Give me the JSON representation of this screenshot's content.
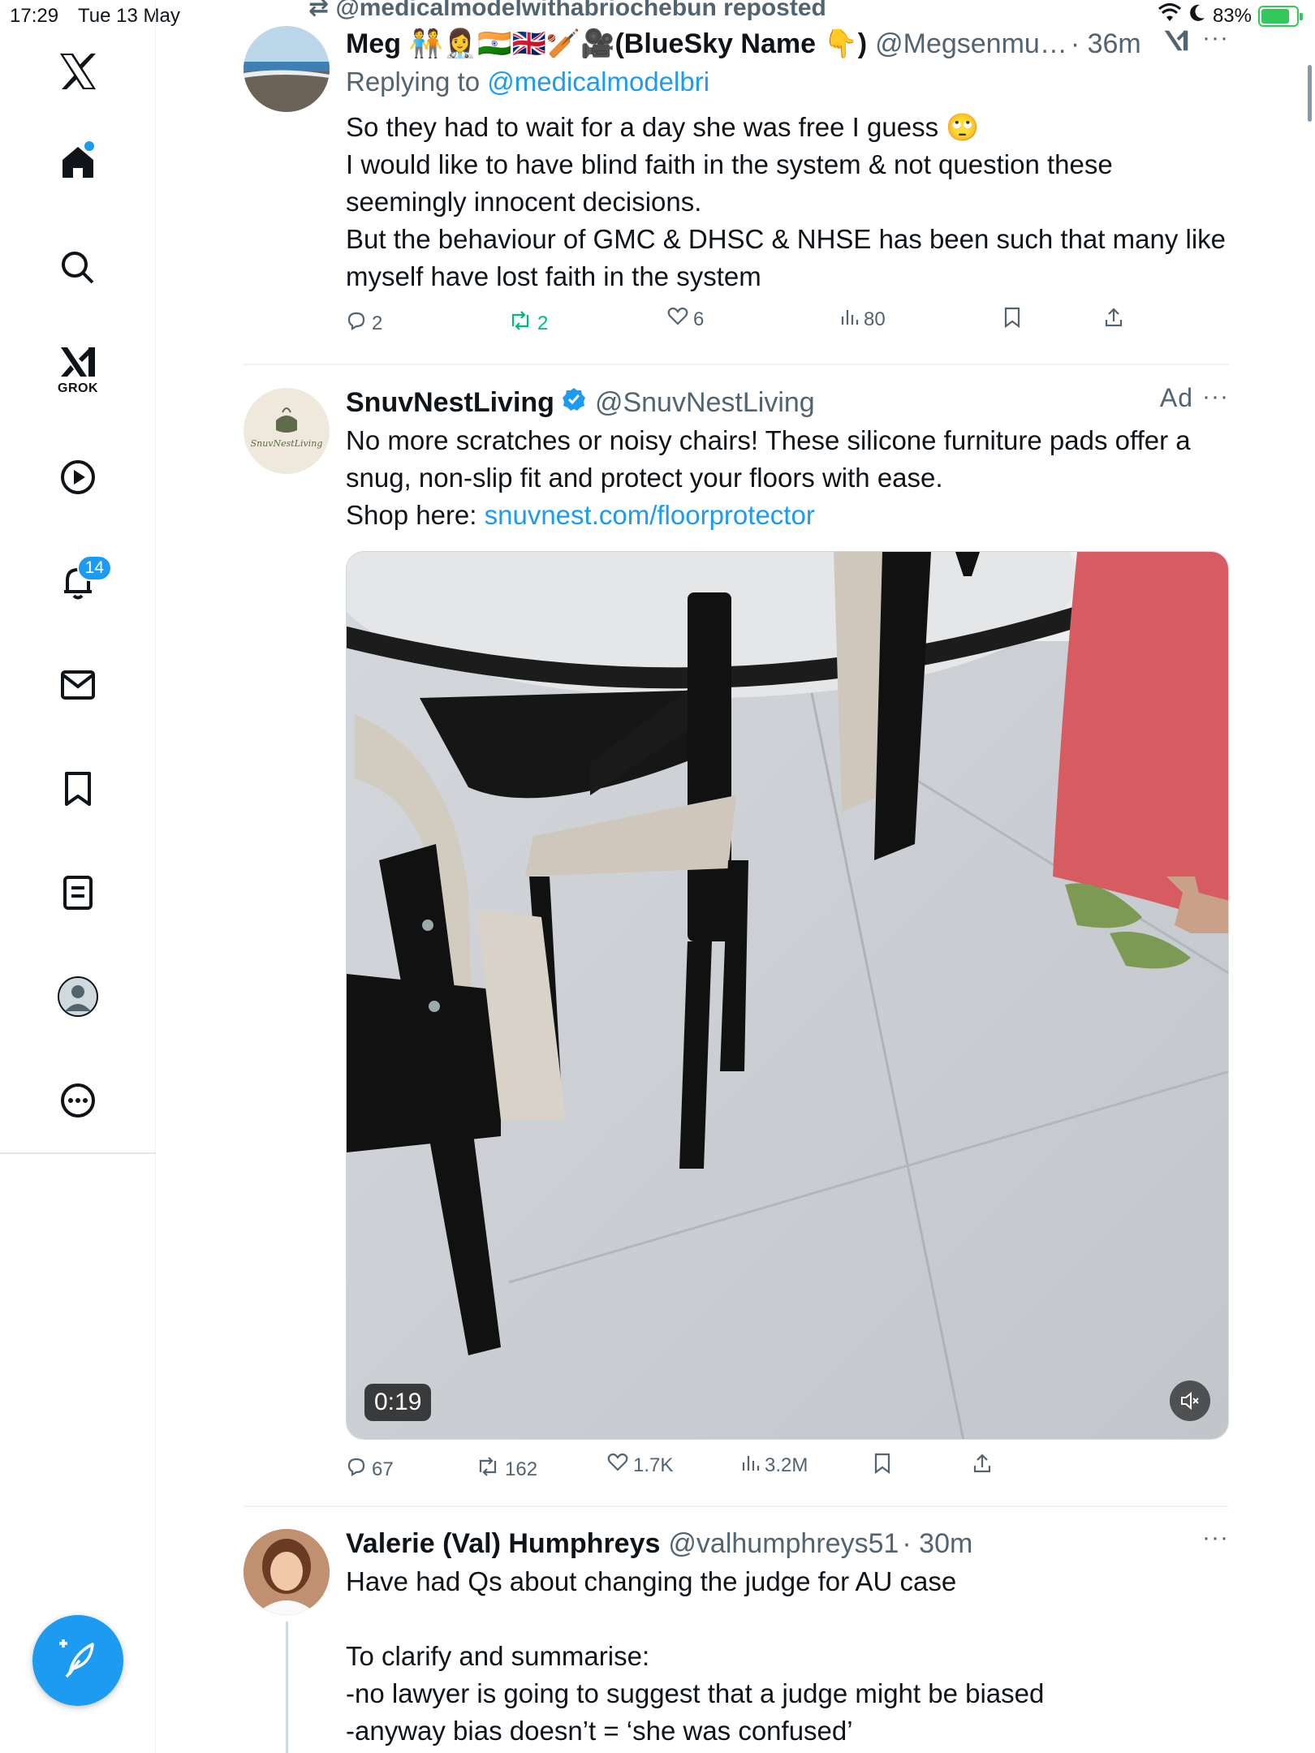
{
  "status_bar": {
    "time": "17:29",
    "date": "Tue 13 May",
    "battery": "83%",
    "battery_level": 0.83
  },
  "sidebar": {
    "items": [
      {
        "name": "x-logo",
        "label": ""
      },
      {
        "name": "home",
        "label": ""
      },
      {
        "name": "search",
        "label": ""
      },
      {
        "name": "grok",
        "label": "GROK"
      },
      {
        "name": "video",
        "label": ""
      },
      {
        "name": "notifications",
        "label": "",
        "badge": "14"
      },
      {
        "name": "messages",
        "label": ""
      },
      {
        "name": "bookmarks",
        "label": ""
      },
      {
        "name": "lists",
        "label": ""
      },
      {
        "name": "profile",
        "label": ""
      },
      {
        "name": "more",
        "label": ""
      }
    ]
  },
  "colors": {
    "accent": "#1d9bf0",
    "text": "#0f1419",
    "muted": "#536471",
    "green": "#00ba7c"
  },
  "feed": {
    "repost_banner": "@medicalmodelwithabriochebun reposted",
    "tweets": [
      {
        "name": "Meg 🧑‍🤝‍🧑👩‍⚕️🇮🇳🇬🇧🏏🎥(BlueSky Name 👇)",
        "handle": "@Megsenmu…",
        "time": "· 36m",
        "replying_label": "Replying to ",
        "replying_to": "@medicalmodelbri",
        "lines": [
          "So they had to wait for a day she was free I guess 🙄",
          "I would like to have blind faith in the system & not question these seemingly innocent decisions.",
          "But the behaviour of GMC & DHSC & NHSE has been such that many like myself have lost faith in the system"
        ],
        "replies": "2",
        "reposts": "2",
        "likes": "6",
        "views": "80"
      },
      {
        "name": "SnuvNestLiving",
        "handle": "@SnuvNestLiving",
        "ad": "Ad",
        "avatar_text": "SnuvNestLiving",
        "line1": "No more scratches or noisy chairs! These silicone furniture pads offer a snug, non-slip fit and protect your floors with ease.",
        "shop_label": "Shop here: ",
        "shop_link": "snuvnest.com/floorprotector",
        "video_duration": "0:19",
        "replies": "67",
        "reposts": "162",
        "likes": "1.7K",
        "views": "3.2M"
      },
      {
        "name": "Valerie (Val) Humphreys",
        "handle": "@valhumphreys51",
        "time": "· 30m",
        "lines": [
          "Have had Qs about changing the judge for AU case",
          "",
          "To clarify and summarise:",
          "-no lawyer is going to suggest that a judge might be biased",
          "-anyway bias doesn’t = ‘she was confused’"
        ]
      }
    ]
  }
}
